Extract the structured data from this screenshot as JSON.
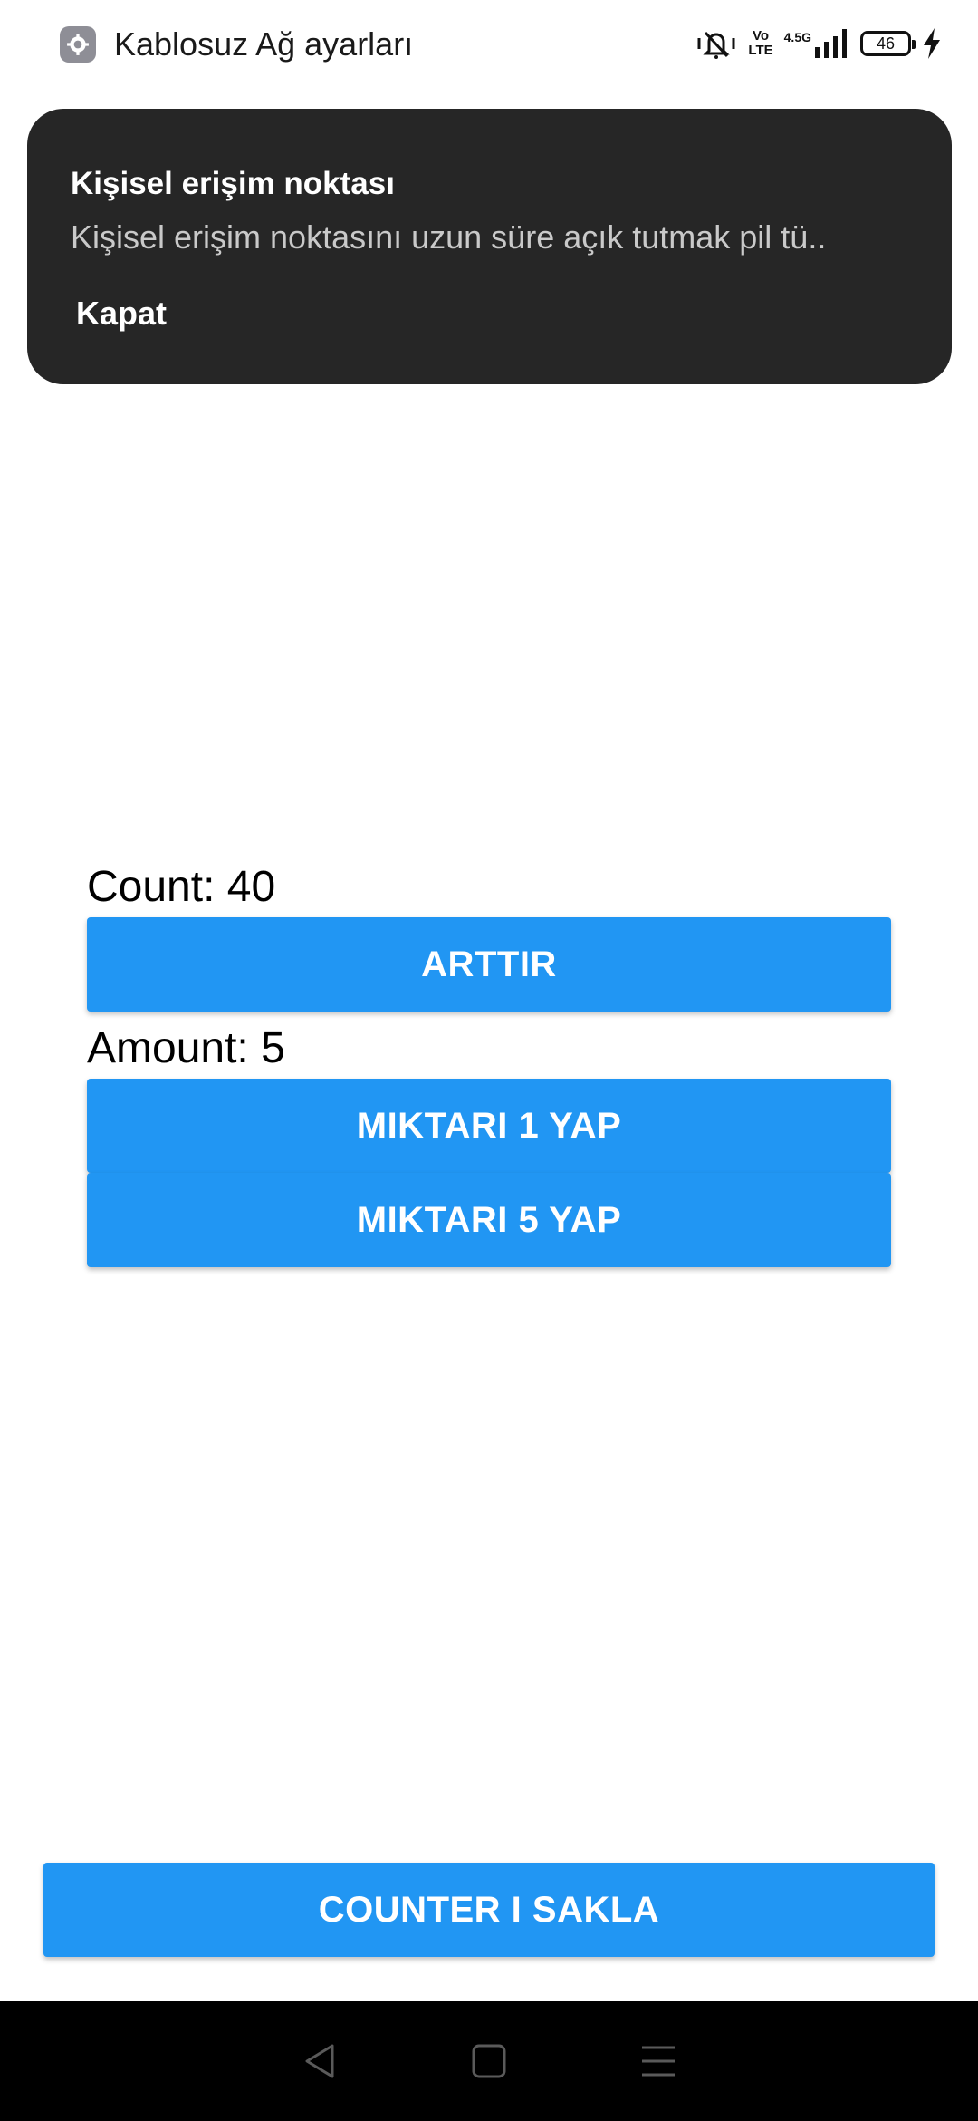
{
  "status_bar": {
    "app_name": "Kablosuz Ağ ayarları",
    "app_icon": "settings-gear-icon",
    "network_type": "4.5G",
    "volte_top": "Vo",
    "volte_bottom": "LTE",
    "battery_level": "46",
    "icons": [
      "mute-vibrate-icon",
      "volte-icon",
      "signal-icon",
      "battery-icon",
      "charging-bolt-icon"
    ]
  },
  "toast": {
    "title": "Kişisel erişim noktası",
    "message": "Kişisel erişim noktasını uzun süre açık tutmak pil tü..",
    "action": "Kapat"
  },
  "counter": {
    "count_label": "Count: 40",
    "increment_button": "ARTTIR",
    "amount_label": "Amount: 5",
    "set_amount_1_button": "MIKTARI 1 YAP",
    "set_amount_5_button": "MIKTARI 5 YAP"
  },
  "footer": {
    "hide_counter_button": "COUNTER I SAKLA"
  },
  "navigation": {
    "icons": [
      "back-icon",
      "home-icon",
      "menu-icon"
    ]
  },
  "colors": {
    "primary": "#2196f3",
    "toast_background": "#262626",
    "nav_background": "#000000"
  }
}
